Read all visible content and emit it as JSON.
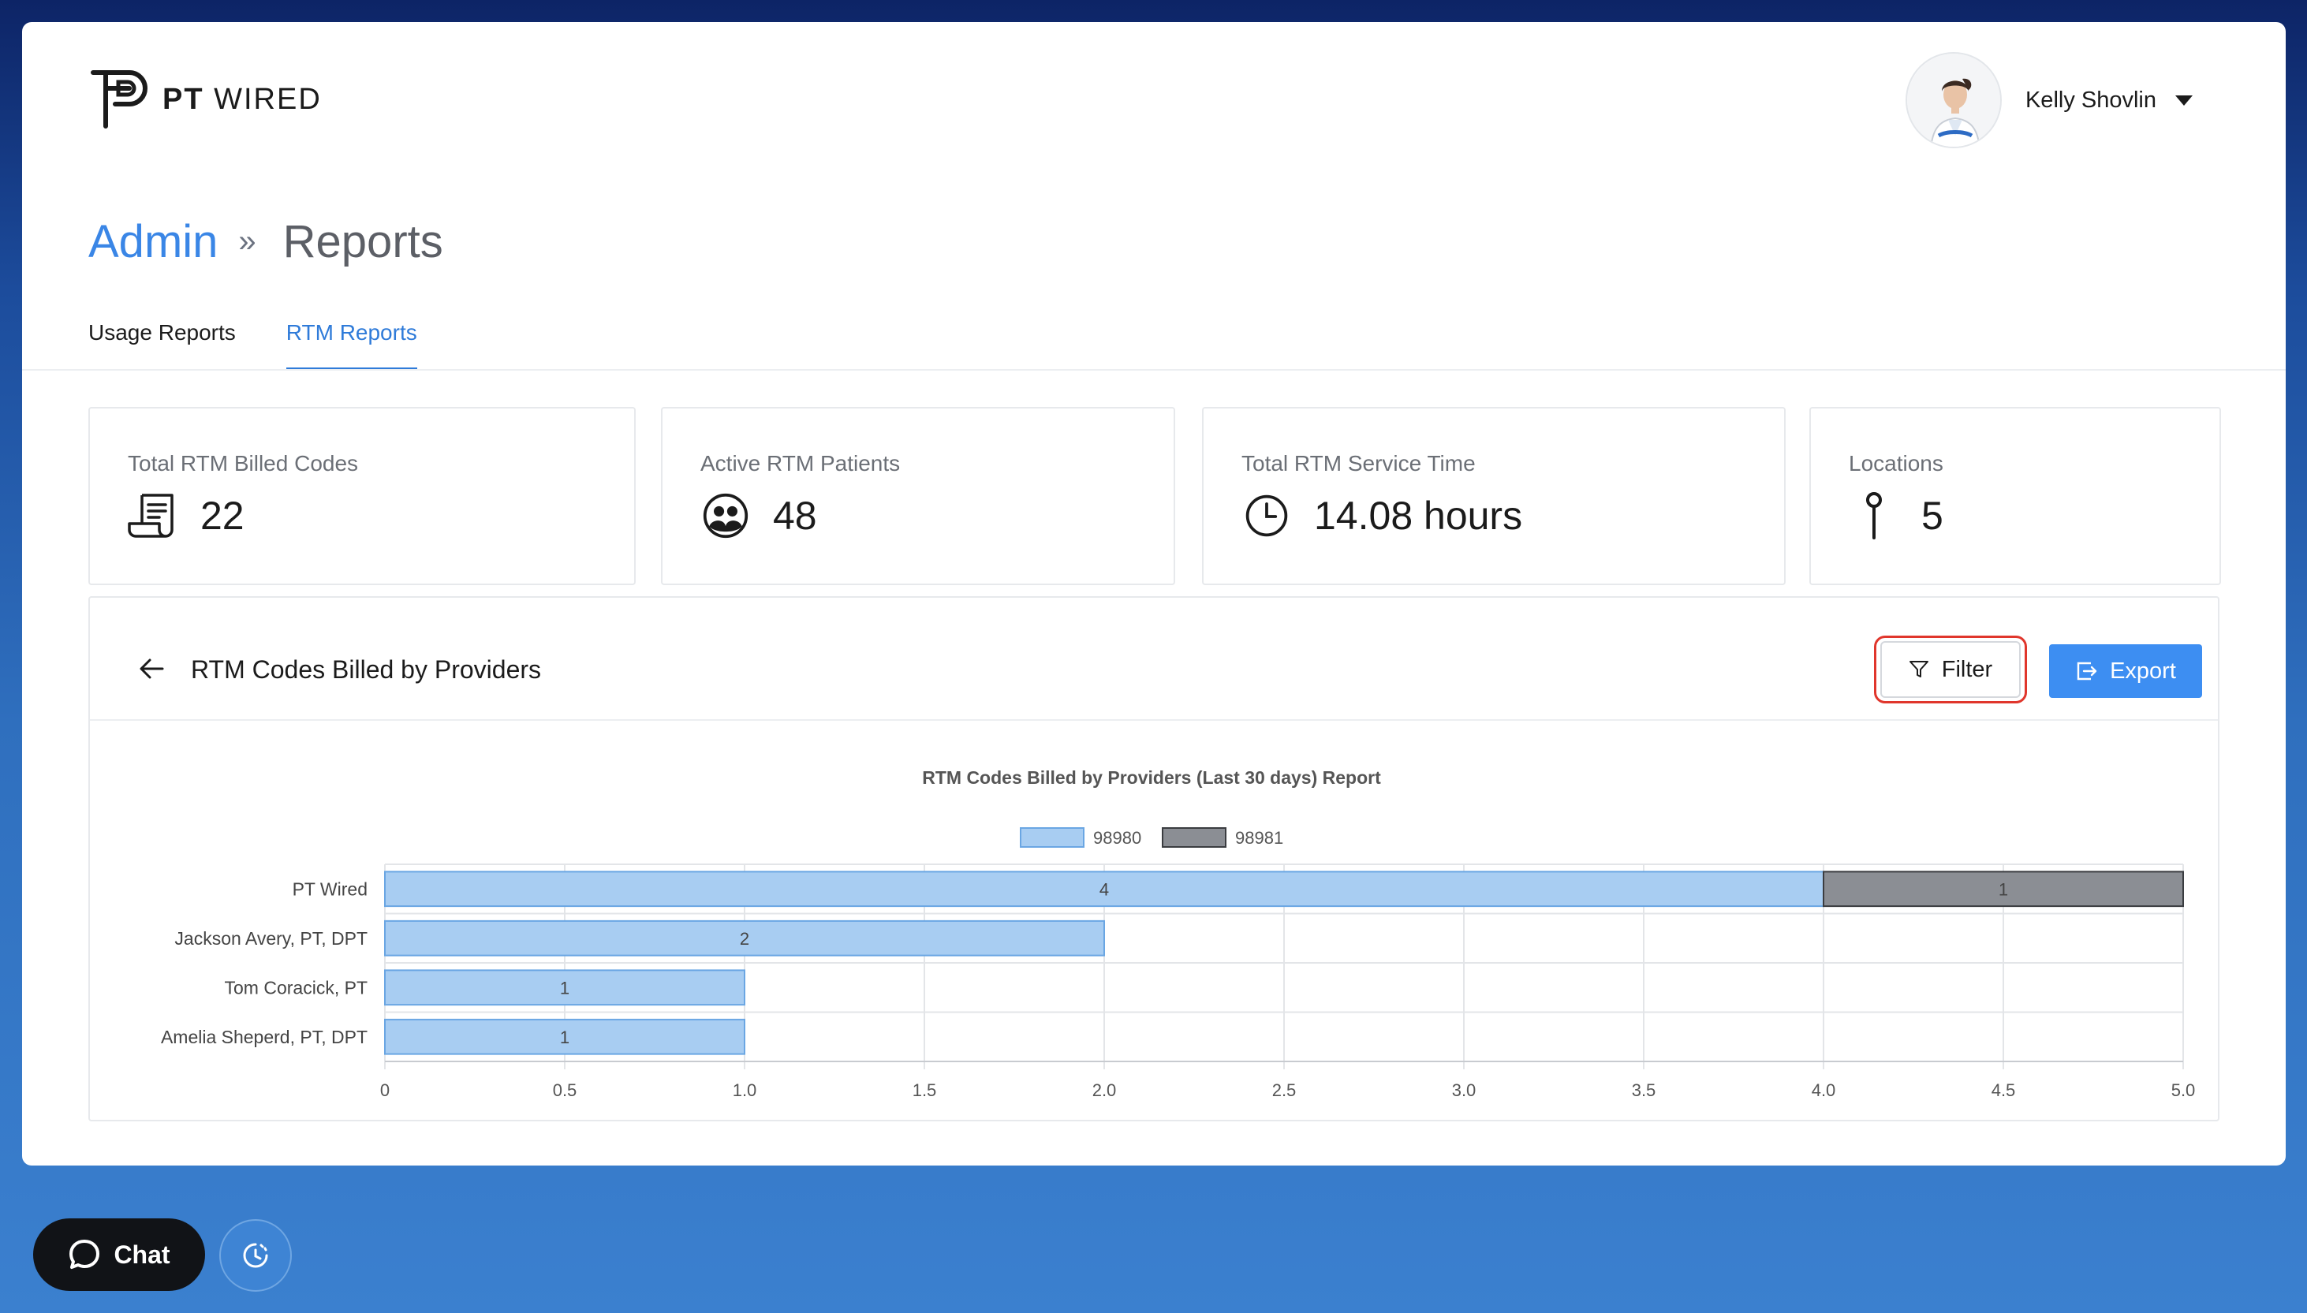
{
  "app": {
    "logo_bold": "PT",
    "logo_light": "WIRED"
  },
  "user": {
    "name": "Kelly Shovlin"
  },
  "breadcrumb": {
    "parent": "Admin",
    "separator": "»",
    "current": "Reports"
  },
  "tabs": [
    {
      "label": "Usage Reports",
      "active": false
    },
    {
      "label": "RTM Reports",
      "active": true
    }
  ],
  "stats": [
    {
      "label": "Total RTM Billed Codes",
      "value": "22",
      "icon": "receipt-icon"
    },
    {
      "label": "Active RTM Patients",
      "value": "48",
      "icon": "patients-icon"
    },
    {
      "label": "Total RTM Service Time",
      "value": "14.08 hours",
      "icon": "clock-icon"
    },
    {
      "label": "Locations",
      "value": "5",
      "icon": "pin-icon"
    }
  ],
  "panel": {
    "title": "RTM Codes Billed by Providers",
    "filter_label": "Filter",
    "export_label": "Export"
  },
  "chart_data": {
    "type": "bar",
    "orientation": "horizontal",
    "stacked": true,
    "title": "RTM Codes Billed by Providers (Last 30 days) Report",
    "categories": [
      "PT Wired",
      "Jackson Avery, PT, DPT",
      "Tom Coracick, PT",
      "Amelia Sheperd, PT, DPT"
    ],
    "series": [
      {
        "name": "98980",
        "values": [
          4,
          2,
          1,
          1
        ],
        "color": "#a8cdf2",
        "stroke": "#6aa6e3"
      },
      {
        "name": "98981",
        "values": [
          1,
          0,
          0,
          0
        ],
        "color": "#8b8e94",
        "stroke": "#3a3c40"
      }
    ],
    "xlim": [
      0,
      5
    ],
    "xticks": [
      "0",
      "0.5",
      "1.0",
      "1.5",
      "2.0",
      "2.5",
      "3.0",
      "3.5",
      "4.0",
      "4.5",
      "5.0"
    ],
    "grid": true,
    "legend": "top-center"
  },
  "floating": {
    "chat_label": "Chat"
  },
  "colors": {
    "accent": "#3a86e6",
    "primary_button": "#3d8ef2",
    "highlight_ring": "#e0362c"
  }
}
